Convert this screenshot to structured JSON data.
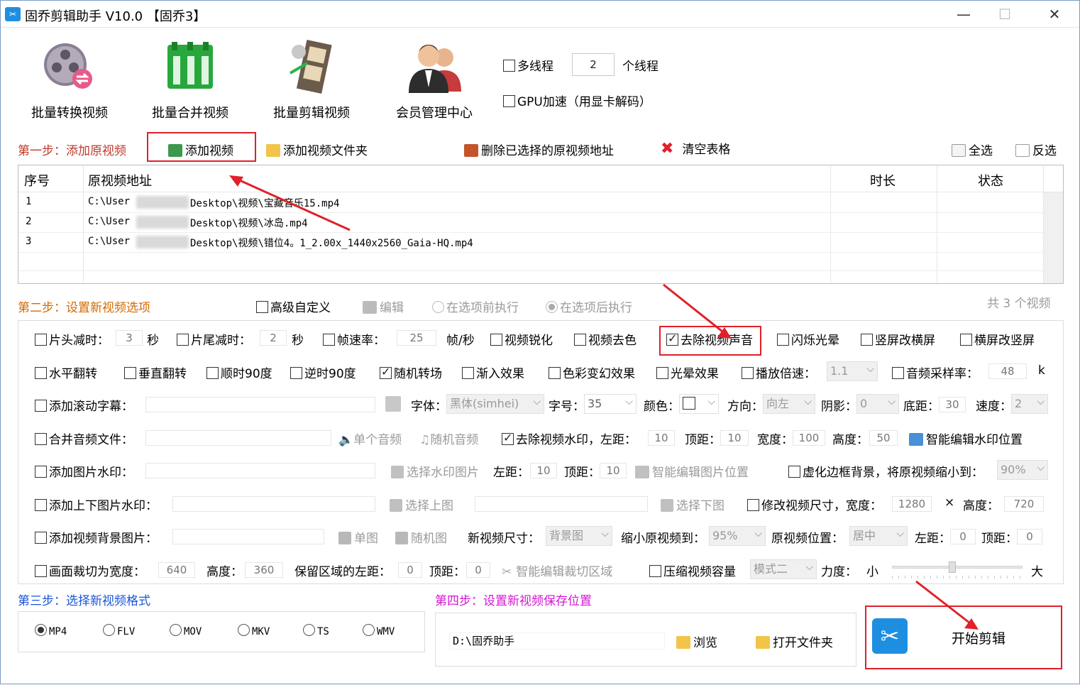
{
  "window": {
    "title": "固乔剪辑助手 V10.0 【固乔3】",
    "app_icon": "scissors-icon",
    "minimize": "—",
    "maximize": "☐",
    "close": "✕"
  },
  "toolbar": {
    "tools": [
      {
        "label": "批量转换视频",
        "icon": "film-reel-convert-icon"
      },
      {
        "label": "批量合并视频",
        "icon": "film-strip-merge-icon"
      },
      {
        "label": "批量剪辑视频",
        "icon": "film-clip-icon"
      },
      {
        "label": "会员管理中心",
        "icon": "users-icon"
      }
    ],
    "multithread_label": "多线程",
    "thread_count": "2",
    "thread_unit": "个线程",
    "gpu_label": "GPU加速（用显卡解码）"
  },
  "step1": {
    "title": "第一步：添加原视频",
    "add_video": "添加视频",
    "add_folder": "添加视频文件夹",
    "delete_selected": "删除已选择的原视频地址",
    "clear_table": "清空表格",
    "select_all": "全选",
    "invert": "反选",
    "columns": [
      "序号",
      "原视频地址",
      "时长",
      "状态"
    ],
    "rows": [
      {
        "no": "1",
        "path": "C:\\User",
        "path2": "Desktop\\视频\\宝藏音乐15.mp4"
      },
      {
        "no": "2",
        "path": "C:\\User",
        "path2": "Desktop\\视频\\冰岛.mp4"
      },
      {
        "no": "3",
        "path": "C:\\User",
        "path2": "Desktop\\视频\\错位4。1_2.00x_1440x2560_Gaia-HQ.mp4"
      }
    ]
  },
  "step2": {
    "title": "第二步：设置新视频选项",
    "advanced": "高级自定义",
    "edit": "编辑",
    "before": "在选项前执行",
    "after": "在选项后执行",
    "count": "共 3 个视频",
    "row1": {
      "head_cut": "片头减时：",
      "head_val": "3",
      "sec1": "秒",
      "tail_cut": "片尾减时：",
      "tail_val": "2",
      "sec2": "秒",
      "fps": "帧速率：",
      "fps_val": "25",
      "fps_unit": "帧/秒",
      "sharpen": "视频锐化",
      "decolor": "视频去色",
      "mute": "去除视频声音",
      "flash": "闪烁光晕",
      "v2h": "竖屏改横屏",
      "h2v": "横屏改竖屏"
    },
    "row2": {
      "hflip": "水平翻转",
      "vflip": "垂直翻转",
      "cw": "顺时90度",
      "ccw": "逆时90度",
      "random": "随机转场",
      "fade": "渐入效果",
      "color": "色彩变幻效果",
      "halo": "光晕效果",
      "speed": "播放倍速：",
      "speed_val": "1.1",
      "sample": "音频采样率：",
      "sample_val": "48",
      "sample_unit": "k"
    },
    "row3": {
      "scroll": "添加滚动字幕：",
      "font": "字体：",
      "font_val": "黑体(simhei)",
      "size": "字号：",
      "size_val": "35",
      "color": "颜色：",
      "dir": "方向：",
      "dir_val": "向左",
      "shadow": "阴影：",
      "shadow_val": "0",
      "bottom": "底距：",
      "bottom_val": "30",
      "spd": "速度：",
      "spd_val": "2"
    },
    "row4": {
      "merge_audio": "合并音频文件：",
      "single": "单个音频",
      "random_audio": "随机音频",
      "remove_wm": "去除视频水印，左距：",
      "left_val": "10",
      "top": "顶距：",
      "top_val": "10",
      "width": "宽度：",
      "width_val": "100",
      "height": "高度：",
      "height_val": "50",
      "smart_wm": "智能编辑水印位置"
    },
    "row5": {
      "img_wm": "添加图片水印：",
      "choose_wm": "选择水印图片",
      "left": "左距：",
      "left_val": "10",
      "top": "顶距：",
      "top_val": "10",
      "smart_img": "智能编辑图片位置",
      "blur": "虚化边框背景，将原视频缩小到：",
      "blur_val": "90%"
    },
    "row6": {
      "updown": "添加上下图片水印：",
      "up": "选择上图",
      "down": "选择下图",
      "resize": "修改视频尺寸，宽度：",
      "w_val": "1280",
      "x": "×",
      "h": "高度：",
      "h_val": "720"
    },
    "row7": {
      "bg": "添加视频背景图片：",
      "single": "单图",
      "random": "随机图",
      "new_size": "新视频尺寸：",
      "new_size_val": "背景图",
      "shrink": "缩小原视频到：",
      "shrink_val": "95%",
      "pos": "原视频位置：",
      "pos_val": "居中",
      "left": "左距：",
      "left_val": "0",
      "top": "顶距：",
      "top_val": "0"
    },
    "row8": {
      "crop": "画面裁切为宽度：",
      "crop_w": "640",
      "h": "高度：",
      "h_val": "360",
      "keep": "保留区域的左距：",
      "keep_val": "0",
      "top": "顶距：",
      "top_val": "0",
      "smart_crop": "智能编辑裁切区域",
      "compress": "压缩视频容量",
      "mode": "模式二",
      "force": "力度：",
      "small": "小",
      "big": "大",
      "force_level": 0.46
    }
  },
  "step3": {
    "title": "第三步：选择新视频格式",
    "formats": [
      "MP4",
      "FLV",
      "MOV",
      "MKV",
      "TS",
      "WMV"
    ]
  },
  "step4": {
    "title": "第四步：设置新视频保存位置",
    "path": "D:\\固乔助手",
    "browse": "浏览",
    "open_folder": "打开文件夹"
  },
  "start": {
    "label": "开始剪辑",
    "icon": "scissors-icon"
  },
  "colors": {
    "accent_red": "#e0202a",
    "step_red": "#c0392b",
    "step_blue": "#1a55d8",
    "step_magenta": "#d417d4",
    "start_icon": "#1e8fe0"
  }
}
